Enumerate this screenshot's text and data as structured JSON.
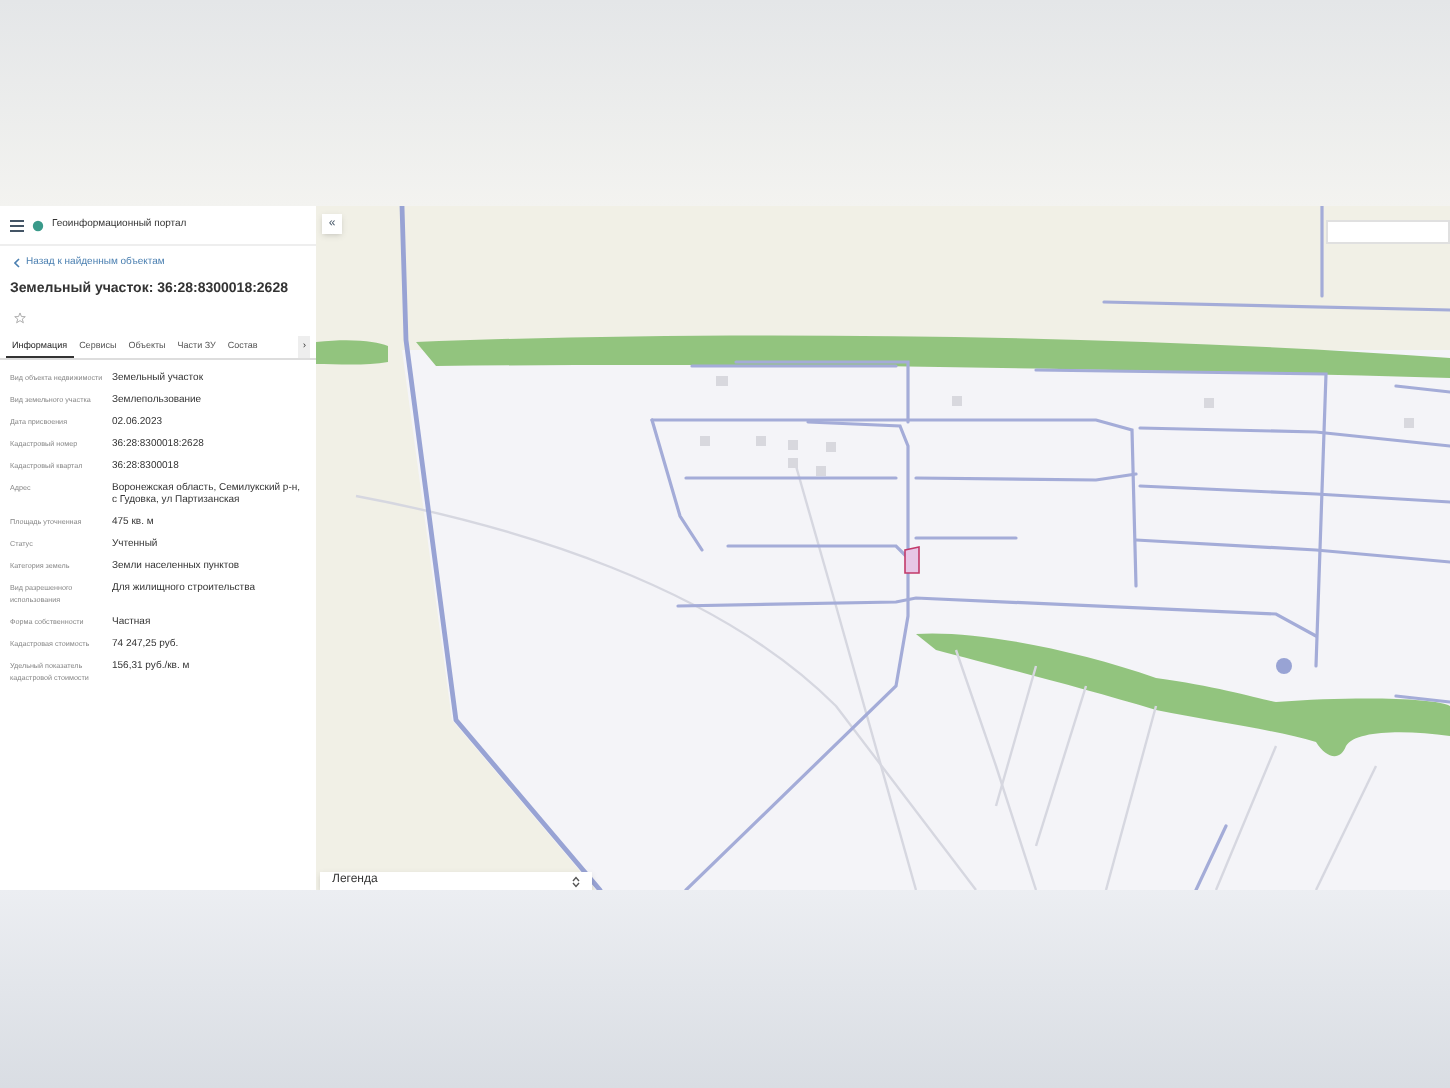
{
  "header": {
    "title": "Геоинформационный портал"
  },
  "back_link": "Назад к найденным объектам",
  "heading": "Земельный участок: 36:28:8300018:2628",
  "tabs": [
    {
      "label": "Информация",
      "selected": true
    },
    {
      "label": "Сервисы",
      "selected": false
    },
    {
      "label": "Объекты",
      "selected": false
    },
    {
      "label": "Части ЗУ",
      "selected": false
    },
    {
      "label": "Состав",
      "selected": false
    }
  ],
  "tabs_scroll": "›",
  "properties": [
    {
      "label": "Вид объекта недвижимости",
      "value": "Земельный участок"
    },
    {
      "label": "Вид земельного участка",
      "value": "Землепользование"
    },
    {
      "label": "Дата присвоения",
      "value": "02.06.2023"
    },
    {
      "label": "Кадастровый номер",
      "value": "36:28:8300018:2628"
    },
    {
      "label": "Кадастровый квартал",
      "value": "36:28:8300018"
    },
    {
      "label": "Адрес",
      "value": "Воронежская область, Семилукский р-н, с Гудовка, ул Партизанская"
    },
    {
      "label": "Площадь уточненная",
      "value": "475 кв. м"
    },
    {
      "label": "Статус",
      "value": "Учтенный"
    },
    {
      "label": "Категория земель",
      "value": "Земли населенных пунктов"
    },
    {
      "label": "Вид разрешенного использования",
      "value": "Для жилищного строительства"
    },
    {
      "label": "Форма собственности",
      "value": "Частная"
    },
    {
      "label": "Кадастровая стоимость",
      "value": "74 247,25 руб."
    },
    {
      "label": "Удельный показатель кадастровой стоимости",
      "value": "156,31 руб./кв. м"
    }
  ],
  "map": {
    "collapse_button": "«",
    "legend": {
      "label": "Легенда"
    }
  }
}
